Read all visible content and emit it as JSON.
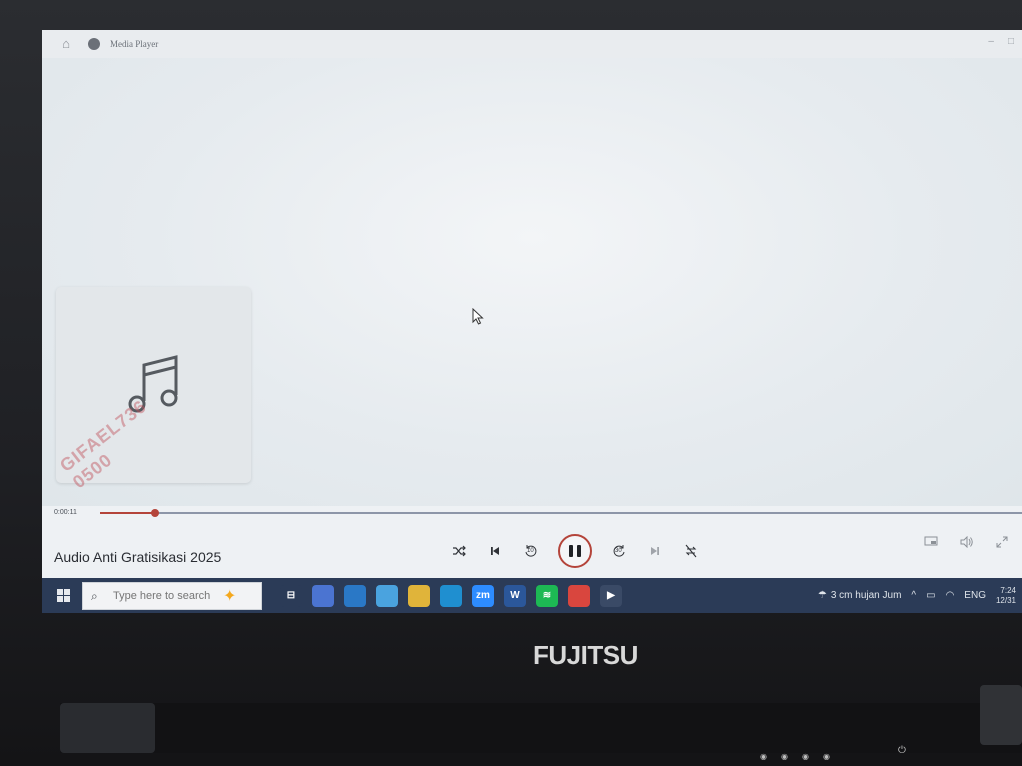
{
  "window": {
    "title": "Media Player",
    "controls": [
      "–",
      "□"
    ]
  },
  "player": {
    "time_elapsed": "0:00:11",
    "progress": 0.06,
    "track_title": "Audio Anti Gratisikasi 2025",
    "watermark_text": "GIFAEL736 0500"
  },
  "transport": {
    "shuffle_icon": "shuffle-icon",
    "previous_icon": "previous-icon",
    "rewind_label": "10",
    "play_state": "pause",
    "forward_label": "30",
    "next_icon": "next-icon",
    "repeat_icon": "repeat-off-icon"
  },
  "right_controls": [
    "miniplayer-icon",
    "volume-icon",
    "fullscreen-icon"
  ],
  "taskbar": {
    "search_placeholder": "Type here to search",
    "apps": [
      {
        "name": "task-view",
        "color": "#2b3b57",
        "label": "⊟"
      },
      {
        "name": "copilot",
        "color": "#4b74d1",
        "label": ""
      },
      {
        "name": "cloud-app",
        "color": "#2a78c6",
        "label": ""
      },
      {
        "name": "store",
        "color": "#4aa3df",
        "label": ""
      },
      {
        "name": "file-explorer",
        "color": "#e0b43a",
        "label": ""
      },
      {
        "name": "edge",
        "color": "#1f8fd0",
        "label": ""
      },
      {
        "name": "zoom",
        "color": "#2d8cff",
        "label": "zm"
      },
      {
        "name": "word",
        "color": "#2b579a",
        "label": "W"
      },
      {
        "name": "spotify",
        "color": "#1db954",
        "label": "≋"
      },
      {
        "name": "chrome",
        "color": "#d9463e",
        "label": ""
      },
      {
        "name": "media-player",
        "color": "#3a4a66",
        "label": "▶"
      }
    ],
    "weather_text": "3 cm hujan Jum",
    "language": "ENG",
    "time": "7:24",
    "date": "12/31"
  },
  "device": {
    "brand": "FUJITSU"
  }
}
